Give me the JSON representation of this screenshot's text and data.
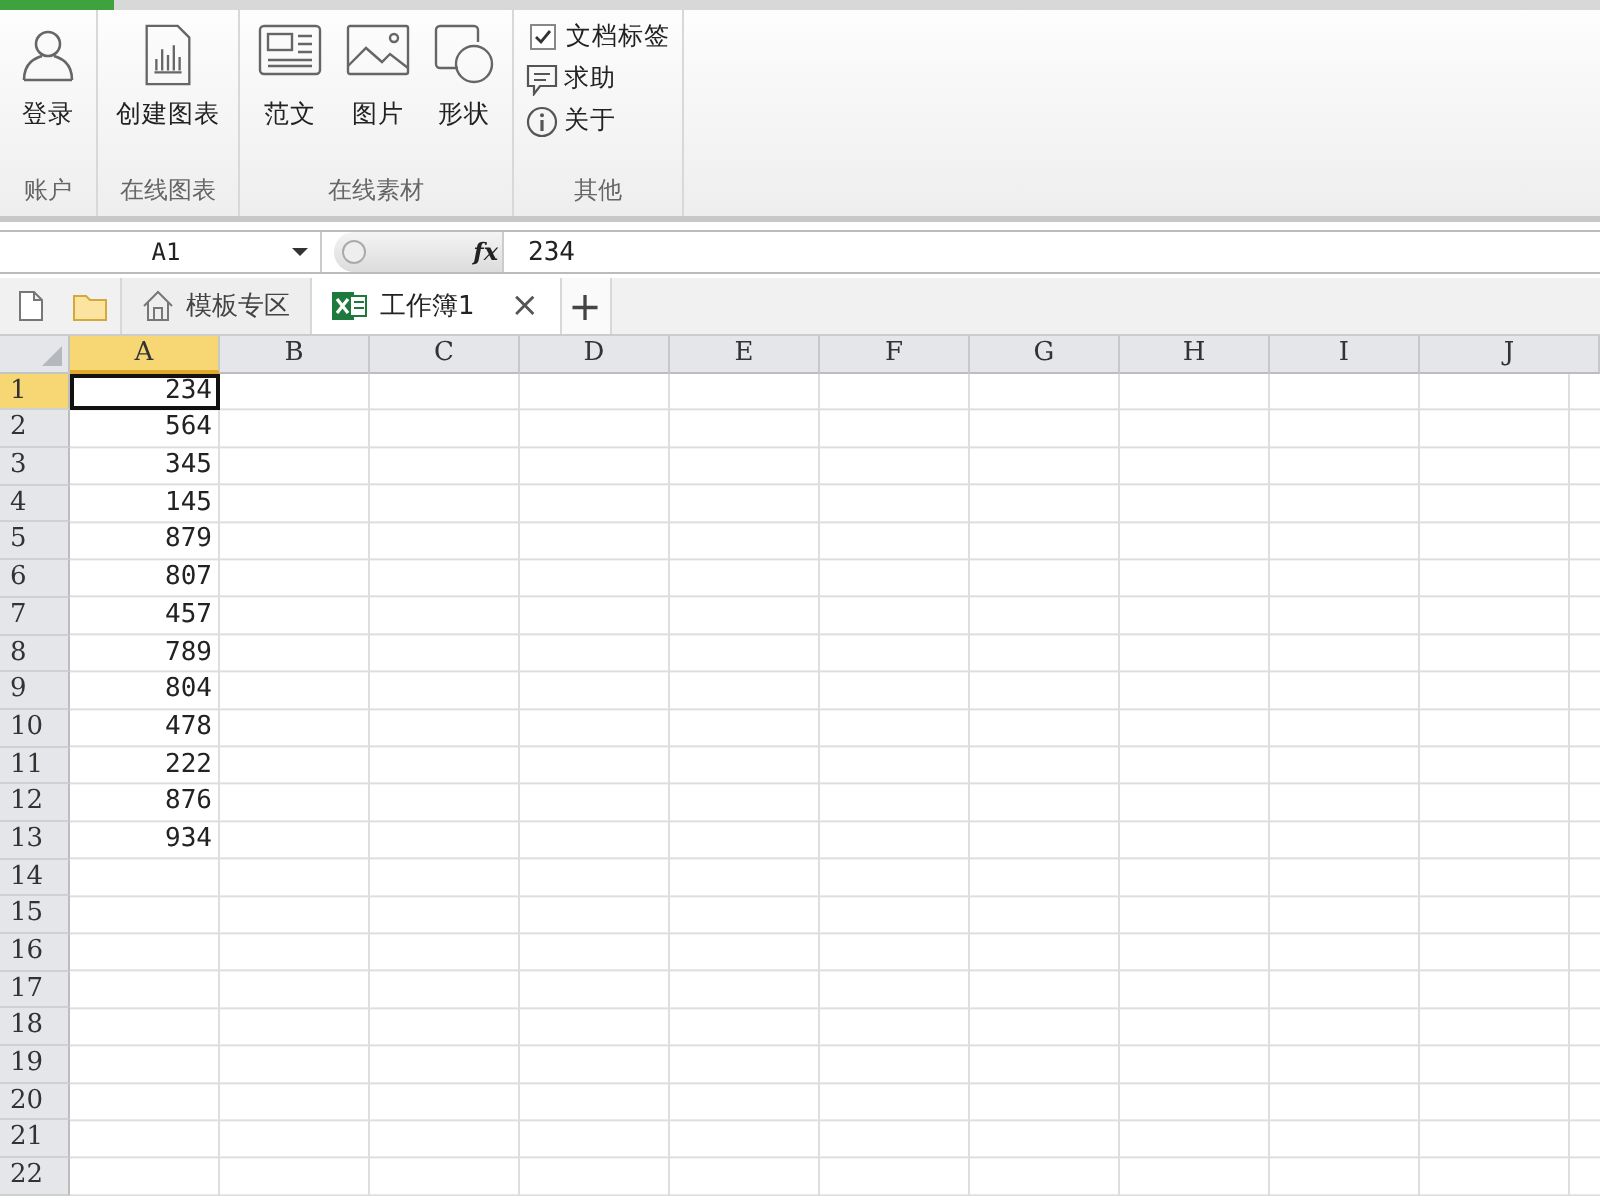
{
  "ribbon": {
    "groups": [
      {
        "label": "账户",
        "items": [
          {
            "kind": "account",
            "label": "登录"
          }
        ]
      },
      {
        "label": "在线图表",
        "items": [
          {
            "kind": "chart",
            "label": "创建图表"
          }
        ]
      },
      {
        "label": "在线素材",
        "items": [
          {
            "kind": "article",
            "label": "范文"
          },
          {
            "kind": "picture",
            "label": "图片"
          },
          {
            "kind": "shape",
            "label": "形状"
          }
        ]
      },
      {
        "label": "其他",
        "items": [
          {
            "kind": "checkbox",
            "label": "文档标签",
            "checked": true
          },
          {
            "kind": "help",
            "label": "求助"
          },
          {
            "kind": "about",
            "label": "关于"
          }
        ]
      }
    ]
  },
  "formula_bar": {
    "name_box": "A1",
    "fx": "fx",
    "value": "234"
  },
  "tabs": [
    {
      "kind": "home",
      "label": "模板专区",
      "selected": false
    },
    {
      "kind": "sheet",
      "label": "工作簿1",
      "selected": true,
      "close": "×"
    }
  ],
  "new_tab": "+",
  "sheet": {
    "columns": [
      {
        "label": "A",
        "selected": true
      },
      {
        "label": "B",
        "selected": false
      },
      {
        "label": "C",
        "selected": false
      },
      {
        "label": "D",
        "selected": false
      },
      {
        "label": "E",
        "selected": false
      },
      {
        "label": "F",
        "selected": false
      },
      {
        "label": "G",
        "selected": false
      },
      {
        "label": "H",
        "selected": false
      },
      {
        "label": "I",
        "selected": false
      },
      {
        "label": "J",
        "selected": false
      }
    ],
    "rows": [
      {
        "label": "1",
        "selected": true,
        "cells": [
          {
            "text": "234",
            "active": true
          }
        ]
      },
      {
        "label": "2",
        "selected": false,
        "cells": [
          {
            "text": "564",
            "active": false
          }
        ]
      },
      {
        "label": "3",
        "selected": false,
        "cells": [
          {
            "text": "345",
            "active": false
          }
        ]
      },
      {
        "label": "4",
        "selected": false,
        "cells": [
          {
            "text": "145",
            "active": false
          }
        ]
      },
      {
        "label": "5",
        "selected": false,
        "cells": [
          {
            "text": "879",
            "active": false
          }
        ]
      },
      {
        "label": "6",
        "selected": false,
        "cells": [
          {
            "text": "807",
            "active": false
          }
        ]
      },
      {
        "label": "7",
        "selected": false,
        "cells": [
          {
            "text": "457",
            "active": false
          }
        ]
      },
      {
        "label": "8",
        "selected": false,
        "cells": [
          {
            "text": "789",
            "active": false
          }
        ]
      },
      {
        "label": "9",
        "selected": false,
        "cells": [
          {
            "text": "804",
            "active": false
          }
        ]
      },
      {
        "label": "10",
        "selected": false,
        "cells": [
          {
            "text": "478",
            "active": false
          }
        ]
      },
      {
        "label": "11",
        "selected": false,
        "cells": [
          {
            "text": "222",
            "active": false
          }
        ]
      },
      {
        "label": "12",
        "selected": false,
        "cells": [
          {
            "text": "876",
            "active": false
          }
        ]
      },
      {
        "label": "13",
        "selected": false,
        "cells": [
          {
            "text": "934",
            "active": false
          }
        ]
      },
      {
        "label": "14",
        "selected": false,
        "cells": []
      },
      {
        "label": "15",
        "selected": false,
        "cells": []
      },
      {
        "label": "16",
        "selected": false,
        "cells": []
      },
      {
        "label": "17",
        "selected": false,
        "cells": []
      },
      {
        "label": "18",
        "selected": false,
        "cells": []
      },
      {
        "label": "19",
        "selected": false,
        "cells": []
      },
      {
        "label": "20",
        "selected": false,
        "cells": []
      },
      {
        "label": "21",
        "selected": false,
        "cells": []
      },
      {
        "label": "22",
        "selected": false,
        "cells": []
      }
    ]
  }
}
